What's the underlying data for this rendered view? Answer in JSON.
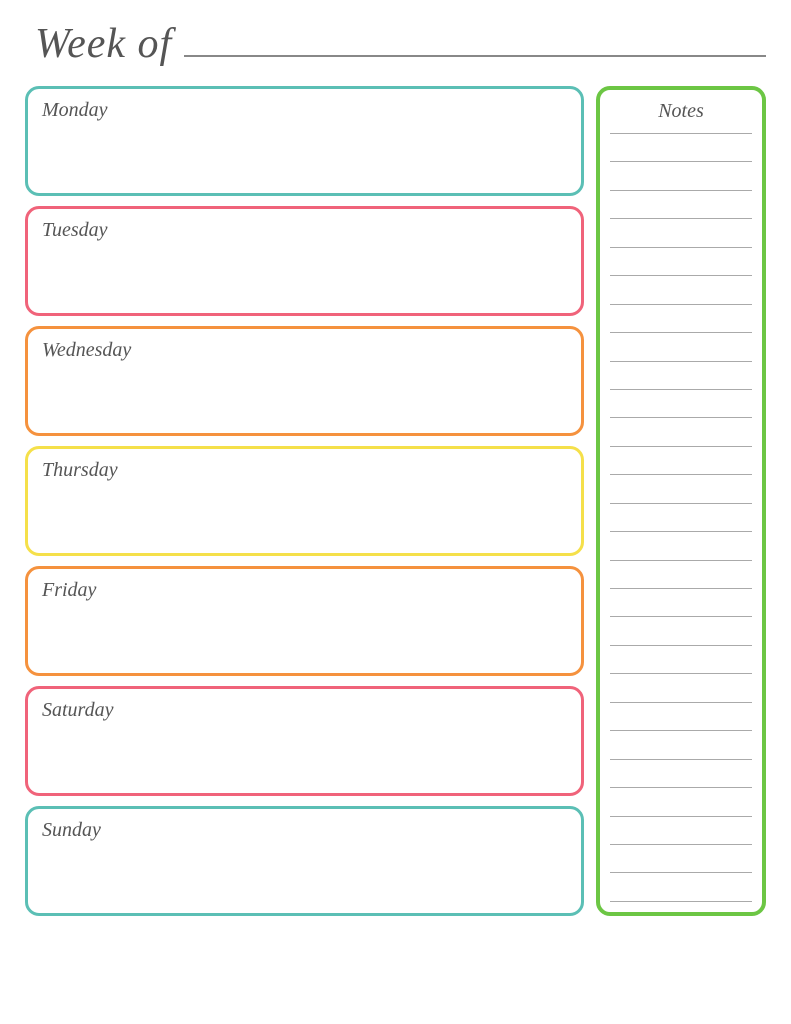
{
  "header": {
    "title": "Week of",
    "line_placeholder": ""
  },
  "days": [
    {
      "id": "monday",
      "label": "Monday",
      "color": "#5bbfb5"
    },
    {
      "id": "tuesday",
      "label": "Tuesday",
      "color": "#f0637a"
    },
    {
      "id": "wednesday",
      "label": "Wednesday",
      "color": "#f5923e"
    },
    {
      "id": "thursday",
      "label": "Thursday",
      "color": "#f5e04a"
    },
    {
      "id": "friday",
      "label": "Friday",
      "color": "#f5923e"
    },
    {
      "id": "saturday",
      "label": "Saturday",
      "color": "#f0637a"
    },
    {
      "id": "sunday",
      "label": "Sunday",
      "color": "#5bbfb5"
    }
  ],
  "notes": {
    "title": "Notes",
    "line_count": 28,
    "border_color": "#6cc644"
  }
}
